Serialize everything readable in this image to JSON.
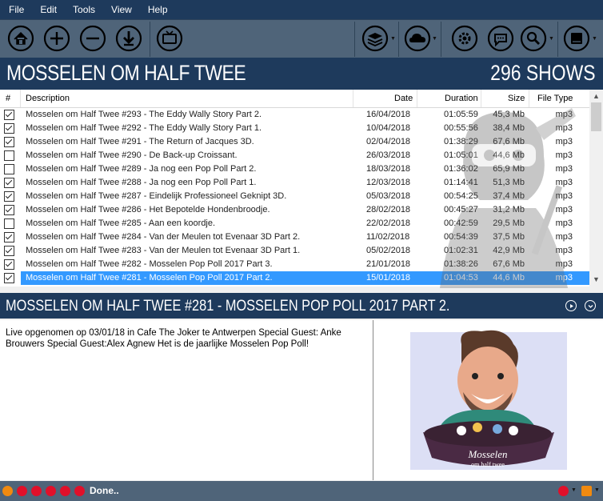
{
  "menu": [
    "File",
    "Edit",
    "Tools",
    "View",
    "Help"
  ],
  "toolbar": {
    "left_icons": [
      "home-icon",
      "add-icon",
      "remove-icon",
      "download-icon",
      "tv-icon"
    ],
    "right_icons": [
      "layers-icon",
      "cloud-icon",
      "settings-icon",
      "chat-icon",
      "search-icon",
      "book-icon"
    ]
  },
  "show": {
    "title": "MOSSELEN OM HALF TWEE",
    "count": "296 SHOWS"
  },
  "columns": {
    "num": "#",
    "description": "Description",
    "date": "Date",
    "duration": "Duration",
    "size": "Size",
    "filetype": "File Type"
  },
  "episodes": [
    {
      "checked": true,
      "description": "Mosselen om Half Twee #293 - The Eddy Wally Story Part 2.",
      "date": "16/04/2018",
      "duration": "01:05:59",
      "size": "45,3 Mb",
      "type": "mp3"
    },
    {
      "checked": true,
      "description": "Mosselen om Half Twee #292 - The Eddy Wally Story Part 1.",
      "date": "10/04/2018",
      "duration": "00:55:56",
      "size": "38,4 Mb",
      "type": "mp3"
    },
    {
      "checked": true,
      "description": "Mosselen om Half Twee #291 - The Return of Jacques 3D.",
      "date": "02/04/2018",
      "duration": "01:38:29",
      "size": "67,6 Mb",
      "type": "mp3"
    },
    {
      "checked": false,
      "description": "Mosselen om Half Twee #290 - De Back-up Croissant.",
      "date": "26/03/2018",
      "duration": "01:05:01",
      "size": "44,6 Mb",
      "type": "mp3"
    },
    {
      "checked": false,
      "description": "Mosselen om Half Twee #289 - Ja nog een Pop Poll Part 2.",
      "date": "18/03/2018",
      "duration": "01:36:02",
      "size": "65,9 Mb",
      "type": "mp3"
    },
    {
      "checked": true,
      "description": "Mosselen om Half Twee #288 - Ja nog een Pop Poll Part 1.",
      "date": "12/03/2018",
      "duration": "01:14:41",
      "size": "51,3 Mb",
      "type": "mp3"
    },
    {
      "checked": true,
      "description": "Mosselen om Half Twee #287 - Eindelijk Professioneel Geknipt 3D.",
      "date": "05/03/2018",
      "duration": "00:54:25",
      "size": "37,4 Mb",
      "type": "mp3"
    },
    {
      "checked": true,
      "description": "Mosselen om Half Twee #286 - Het Bepotelde Hondenbroodje.",
      "date": "28/02/2018",
      "duration": "00:45:27",
      "size": "31,2 Mb",
      "type": "mp3"
    },
    {
      "checked": false,
      "description": "Mosselen om Half Twee #285 - Aan een koordje.",
      "date": "22/02/2018",
      "duration": "00:42:59",
      "size": "29,5 Mb",
      "type": "mp3"
    },
    {
      "checked": true,
      "description": "Mosselen om Half Twee #284 - Van der Meulen tot Evenaar 3D Part 2.",
      "date": "11/02/2018",
      "duration": "00:54:39",
      "size": "37,5 Mb",
      "type": "mp3"
    },
    {
      "checked": true,
      "description": "Mosselen om Half Twee #283 - Van der Meulen tot Evenaar 3D Part 1.",
      "date": "05/02/2018",
      "duration": "01:02:31",
      "size": "42,9 Mb",
      "type": "mp3"
    },
    {
      "checked": true,
      "description": "Mosselen om Half Twee #282 - Mosselen Pop Poll 2017 Part 3.",
      "date": "21/01/2018",
      "duration": "01:38:26",
      "size": "67,6 Mb",
      "type": "mp3"
    },
    {
      "checked": true,
      "description": "Mosselen om Half Twee #281 - Mosselen Pop Poll 2017 Part 2.",
      "date": "15/01/2018",
      "duration": "01:04:53",
      "size": "44,6 Mb",
      "type": "mp3",
      "selected": true
    }
  ],
  "episode": {
    "title": "MOSSELEN OM HALF TWEE #281 - MOSSELEN POP POLL 2017 PART 2.",
    "description": "Live opgenomen op 03/01/18 in Cafe The Joker te Antwerpen Special Guest: Anke Brouwers Special Guest:Alex Agnew Het is de jaarlijke Mosselen Pop Poll!",
    "artwork_text": "Mosselen om half twee"
  },
  "status": {
    "text": "Done..",
    "accent": "#e0102a"
  }
}
